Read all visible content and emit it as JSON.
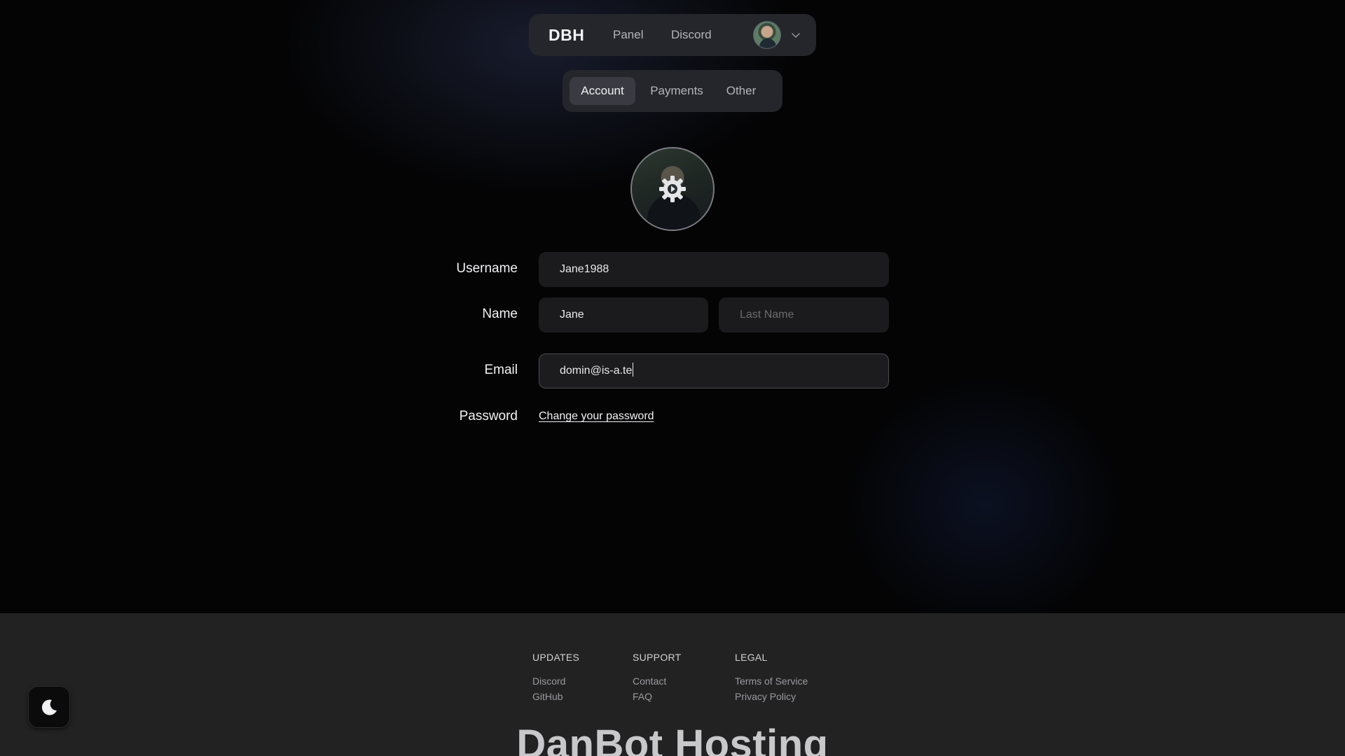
{
  "nav": {
    "brand": "DBH",
    "links": [
      "Panel",
      "Discord"
    ],
    "user_menu_icon": "chevron-down-icon"
  },
  "tabs": [
    {
      "label": "Account",
      "active": true
    },
    {
      "label": "Payments",
      "active": false
    },
    {
      "label": "Other",
      "active": false
    }
  ],
  "profile": {
    "avatar_overlay_icon": "gear-icon"
  },
  "form": {
    "username": {
      "label": "Username",
      "value": "Jane1988"
    },
    "name": {
      "label": "Name",
      "first_value": "Jane",
      "last_placeholder": "Last Name"
    },
    "email": {
      "label": "Email",
      "value": "domin@is-a.te"
    },
    "password": {
      "label": "Password",
      "link": "Change your password"
    }
  },
  "footer": {
    "columns": [
      {
        "heading": "UPDATES",
        "links": [
          "Discord",
          "GitHub"
        ]
      },
      {
        "heading": "SUPPORT",
        "links": [
          "Contact",
          "FAQ"
        ]
      },
      {
        "heading": "LEGAL",
        "links": [
          "Terms of Service",
          "Privacy Policy"
        ]
      }
    ],
    "big_brand": "DanBot Hosting"
  },
  "theme_toggle": {
    "icon": "moon-icon"
  },
  "colors": {
    "background": "#040405",
    "card": "#25262c",
    "active_tab": "#3a3b42",
    "input_bg": "#1b1b1d",
    "footer_bg": "#222222"
  }
}
